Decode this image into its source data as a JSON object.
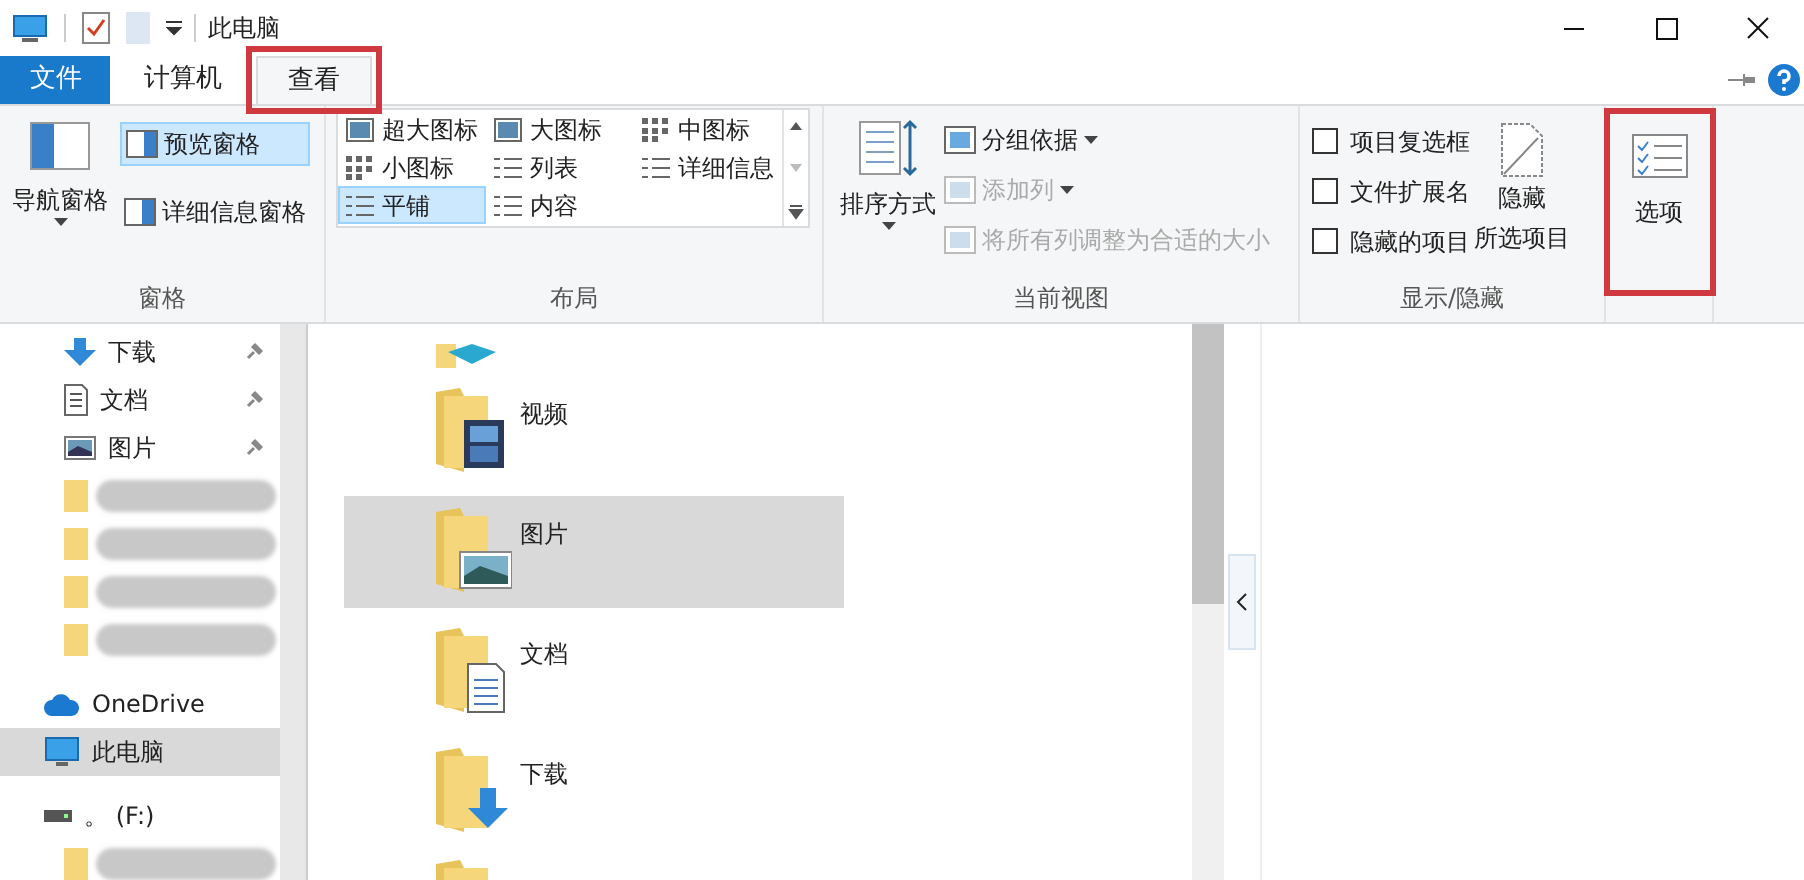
{
  "title_bar": {
    "title": "此电脑"
  },
  "ribbon_tabs": [
    {
      "label": "文件",
      "kind": "file",
      "selected": false,
      "highlighted": false
    },
    {
      "label": "计算机",
      "kind": "tab",
      "selected": false,
      "highlighted": false
    },
    {
      "label": "查看",
      "kind": "tab",
      "selected": true,
      "highlighted": true
    }
  ],
  "panes_group": {
    "label": "窗格",
    "nav_pane": "导航窗格",
    "preview_pane": {
      "label": "预览窗格",
      "selected": true
    },
    "details_pane": {
      "label": "详细信息窗格",
      "selected": false
    }
  },
  "layout_group": {
    "label": "布局",
    "options": [
      {
        "label": "超大图标",
        "kind": "xl",
        "selected": false
      },
      {
        "label": "大图标",
        "kind": "large",
        "selected": false
      },
      {
        "label": "中图标",
        "kind": "medium",
        "selected": false
      },
      {
        "label": "小图标",
        "kind": "small",
        "selected": false
      },
      {
        "label": "列表",
        "kind": "list",
        "selected": false
      },
      {
        "label": "详细信息",
        "kind": "details",
        "selected": false
      },
      {
        "label": "平铺",
        "kind": "tiles",
        "selected": true
      },
      {
        "label": "内容",
        "kind": "content",
        "selected": false
      }
    ]
  },
  "current_view_group": {
    "label": "当前视图",
    "sort": "排序方式",
    "group_by": {
      "label": "分组依据",
      "disabled": false
    },
    "add_column": {
      "label": "添加列",
      "disabled": true
    },
    "fit_columns": {
      "label": "将所有列调整为合适的大小",
      "disabled": true
    }
  },
  "show_hide_group": {
    "label": "显示/隐藏",
    "checkboxes": [
      {
        "label": "项目复选框",
        "checked": false
      },
      {
        "label": "文件扩展名",
        "checked": false
      },
      {
        "label": "隐藏的项目",
        "checked": false
      }
    ],
    "hide_selected": [
      "隐藏",
      "所选项目"
    ]
  },
  "options_button": {
    "label": "选项",
    "highlighted": true
  },
  "sidebar": {
    "items": [
      {
        "label": "下载",
        "kind": "download",
        "pinned": true,
        "selected": false
      },
      {
        "label": "文档",
        "kind": "document",
        "pinned": true,
        "selected": false
      },
      {
        "label": "图片",
        "kind": "pictures",
        "pinned": true,
        "selected": false
      },
      {
        "kind": "blurred"
      },
      {
        "kind": "blurred"
      },
      {
        "kind": "blurred"
      },
      {
        "kind": "blurred"
      },
      {
        "label": "OneDrive",
        "kind": "cloud",
        "pinned": false,
        "selected": false
      },
      {
        "label": "此电脑",
        "kind": "computer",
        "pinned": false,
        "selected": true
      },
      {
        "label": "。 (F:)",
        "kind": "drive",
        "pinned": false,
        "selected": false
      },
      {
        "kind": "blurred"
      }
    ]
  },
  "content": {
    "items": [
      {
        "label": "视频",
        "kind": "videos",
        "selected": false
      },
      {
        "label": "图片",
        "kind": "pictures",
        "selected": true
      },
      {
        "label": "文档",
        "kind": "document",
        "selected": false
      },
      {
        "label": "下载",
        "kind": "download",
        "selected": false
      }
    ]
  }
}
